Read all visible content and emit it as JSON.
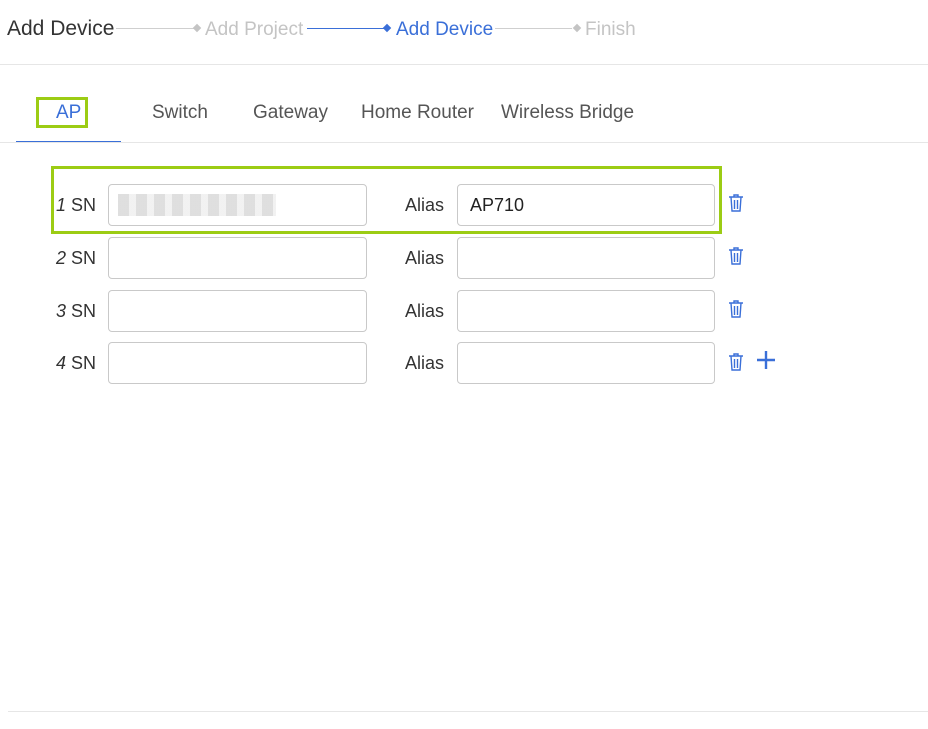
{
  "header": {
    "title": "Add Device"
  },
  "steps": [
    {
      "label": "Add Project",
      "state": "done"
    },
    {
      "label": "Add Device",
      "state": "active"
    },
    {
      "label": "Finish",
      "state": "pending"
    }
  ],
  "tabs": [
    {
      "label": "AP",
      "active": true
    },
    {
      "label": "Switch"
    },
    {
      "label": "Gateway"
    },
    {
      "label": "Home Router"
    },
    {
      "label": "Wireless Bridge"
    }
  ],
  "rows": [
    {
      "index": "1",
      "sn_label": "SN",
      "alias_label": "Alias",
      "sn_value": "",
      "alias_value": "AP710"
    },
    {
      "index": "2",
      "sn_label": "SN",
      "alias_label": "Alias",
      "sn_value": "",
      "alias_value": ""
    },
    {
      "index": "3",
      "sn_label": "SN",
      "alias_label": "Alias",
      "sn_value": "",
      "alias_value": ""
    },
    {
      "index": "4",
      "sn_label": "SN",
      "alias_label": "Alias",
      "sn_value": "",
      "alias_value": ""
    }
  ],
  "colors": {
    "accent": "#3a6fd8",
    "highlight": "#9ccc14",
    "muted": "#c4c4c4"
  },
  "icons": {
    "delete": "trash-icon",
    "add": "plus-icon"
  }
}
